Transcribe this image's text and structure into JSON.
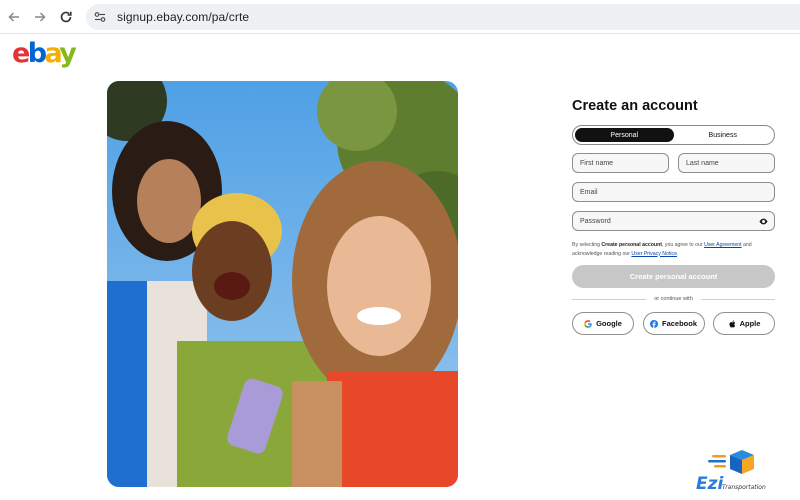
{
  "browser": {
    "url": "signup.ebay.com/pa/crte"
  },
  "logo": {
    "letters": [
      "e",
      "b",
      "a",
      "y"
    ],
    "colors": [
      "#e53238",
      "#0064d2",
      "#f5af02",
      "#86b817"
    ]
  },
  "form": {
    "title": "Create an account",
    "tabs": [
      {
        "label": "Personal",
        "active": true
      },
      {
        "label": "Business",
        "active": false
      }
    ],
    "first_name_placeholder": "First name",
    "last_name_placeholder": "Last name",
    "email_placeholder": "Email",
    "password_placeholder": "Password",
    "legal": {
      "prefix": "By selecting ",
      "bold": "Create personal account",
      "mid": ", you agree to our ",
      "link1": "User Agreement",
      "mid2": " and acknowledge reading our ",
      "link2": "User Privacy Notice",
      "suffix": "."
    },
    "create_button": "Create personal account",
    "divider_text": "or continue with",
    "social_buttons": [
      {
        "label": "Google",
        "icon": "google-icon"
      },
      {
        "label": "Facebook",
        "icon": "facebook-icon"
      },
      {
        "label": "Apple",
        "icon": "apple-icon"
      }
    ]
  },
  "watermark": {
    "brand": "Ezi",
    "tagline": "Transportation"
  },
  "colors": {
    "accent_dark": "#111111",
    "disabled_button": "#c7c7c7",
    "link": "#0645ad"
  }
}
